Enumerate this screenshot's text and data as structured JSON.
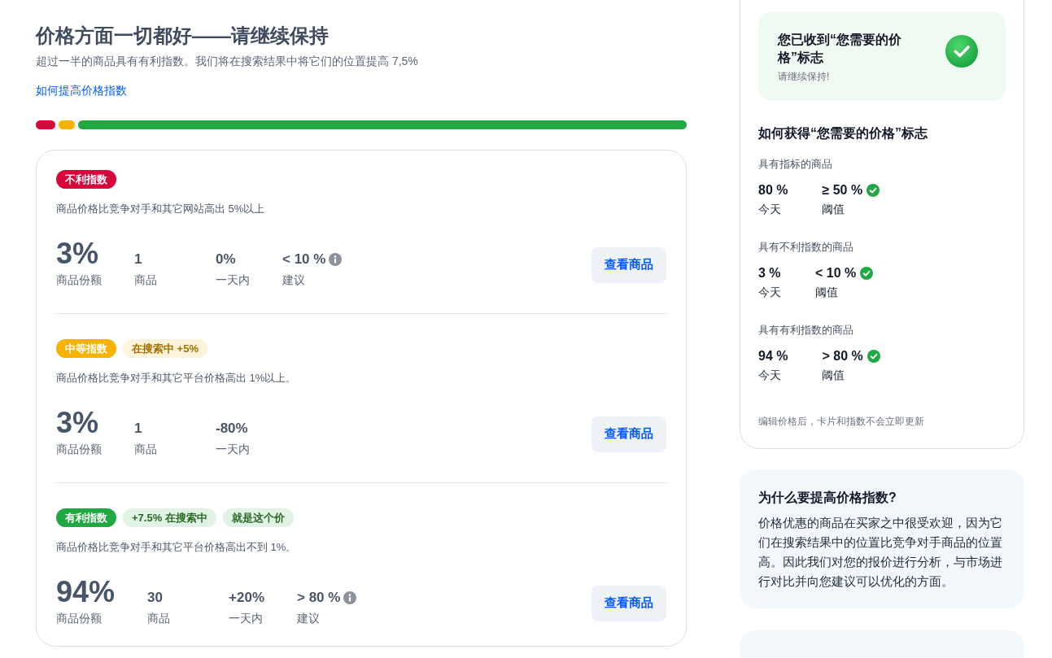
{
  "header": {
    "title": "价格方面一切都好——请继续保持",
    "subtitle": "超过一半的商品具有有利指数。我们将在搜索结果中将它们的位置提高 7,5%",
    "link": "如何提高价格指数"
  },
  "share_bar": {
    "segments": [
      {
        "level": 0.03,
        "color": "#d6083b"
      },
      {
        "level": 0.03,
        "color": "#f5b300"
      },
      {
        "level": 0.94,
        "color": "#20a843"
      }
    ]
  },
  "index_groups": [
    {
      "color": "#d6083b",
      "badge": "不利指数",
      "description": "商品价格比竞争对手和其它网站高出 5%以上",
      "stats": [
        {
          "kind": "share",
          "value": "3%",
          "label": "商品份额"
        },
        {
          "kind": "count",
          "value": "1",
          "label": "商品"
        },
        {
          "kind": "change",
          "value": "0%",
          "label": "一天内"
        },
        {
          "kind": "advice",
          "value": "< 10 %",
          "label": "建议"
        }
      ],
      "button": "查看商品"
    },
    {
      "color": "#f5b300",
      "badge": "中等指数",
      "tags": [
        "在搜索中 +5%"
      ],
      "description": "商品价格比竞争对手和其它平台价格高出 1%以上。",
      "stats": [
        {
          "kind": "share",
          "value": "3%",
          "label": "商品份额"
        },
        {
          "kind": "count",
          "value": "1",
          "label": "商品"
        },
        {
          "kind": "change",
          "value": "-80%",
          "label": "一天内"
        }
      ],
      "button": "查看商品"
    },
    {
      "color": "#20a843",
      "badge": "有利指数",
      "tags": [
        "+7.5% 在搜索中",
        "就是这个价"
      ],
      "description": "商品价格比竞争对手和其它平台价格高出不到 1%。",
      "stats": [
        {
          "kind": "share",
          "value": "94%",
          "label": "商品份额"
        },
        {
          "kind": "count",
          "value": "30",
          "label": "商品"
        },
        {
          "kind": "change",
          "value": "+20%",
          "label": "一天内"
        },
        {
          "kind": "advice",
          "value": "> 80 %",
          "label": "建议"
        }
      ],
      "button": "查看商品"
    }
  ],
  "badge_panel": {
    "status": {
      "title": "您已收到“您需要的价格”标志",
      "subtitle": "请继续保持!"
    },
    "heading": "如何获得“您需要的价格”标志",
    "criteria": [
      {
        "label": "具有指标的商品",
        "today": "80 %",
        "today_label": "今天",
        "threshold": "≥ 50 %",
        "threshold_label": "阈值",
        "met": true
      },
      {
        "label": "具有不利指数的商品",
        "today": "3 %",
        "today_label": "今天",
        "threshold": "< 10 %",
        "threshold_label": "阈值",
        "met": true
      },
      {
        "label": "具有有利指数的商品",
        "today": "94 %",
        "today_label": "今天",
        "threshold": "> 80 %",
        "threshold_label": "阈值",
        "met": true
      }
    ],
    "note": "编辑价格后，卡片和指数不会立即更新"
  },
  "info_cards": [
    {
      "title": "为什么要提高价格指数?",
      "body": "价格优惠的商品在买家之中很受欢迎，因为它们在搜索结果中的位置比竞争对手商品的位置高。因此我们对您的报价进行分析，与市场进行对比并向您建议可以优化的方面。"
    }
  ]
}
